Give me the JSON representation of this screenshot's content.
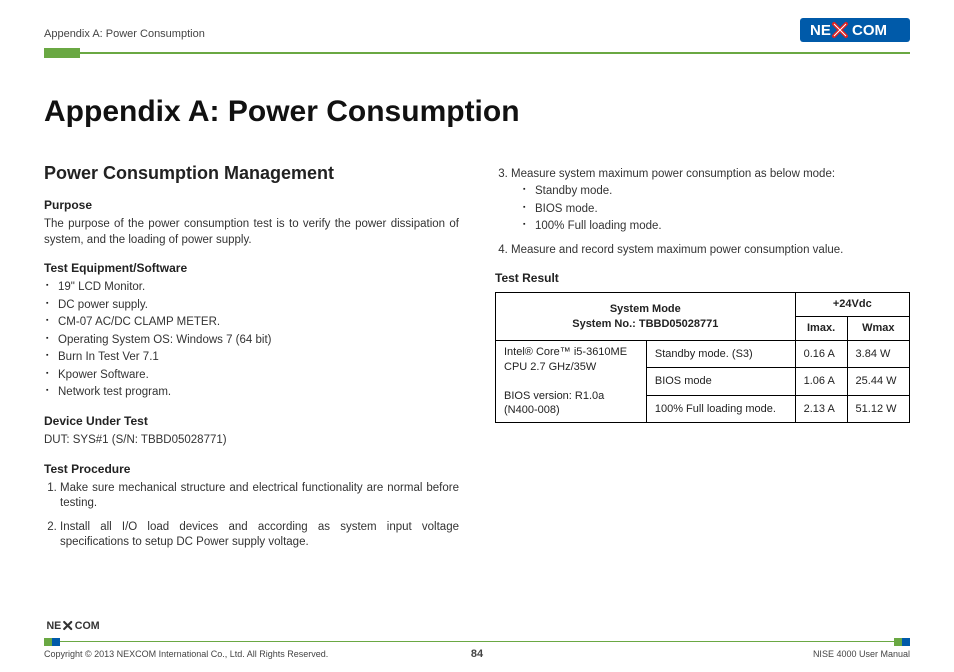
{
  "header": {
    "running_head": "Appendix A: Power Consumption",
    "logo_text_left": "NE",
    "logo_text_right": "COM"
  },
  "title": "Appendix A: Power Consumption",
  "left": {
    "section_title": "Power Consumption Management",
    "purpose_h": "Purpose",
    "purpose_p": "The purpose of the power consumption test is to verify the power dissipation of system, and the loading of power supply.",
    "equip_h": "Test Equipment/Software",
    "equip": [
      "19\" LCD Monitor.",
      "DC power supply.",
      "CM-07 AC/DC CLAMP METER.",
      "Operating System OS: Windows 7 (64 bit)",
      "Burn In Test Ver 7.1",
      "Kpower Software.",
      "Network test program."
    ],
    "dut_h": "Device Under Test",
    "dut_p": "DUT: SYS#1 (S/N: TBBD05028771)",
    "proc_h": "Test Procedure",
    "proc1": "Make sure mechanical structure and electrical functionality are normal before testing.",
    "proc2": "Install all I/O load devices and according as system input voltage specifications to setup DC Power supply voltage."
  },
  "right": {
    "proc3_lead": "Measure system maximum power consumption as below mode:",
    "proc3_items": [
      "Standby mode.",
      "BIOS mode.",
      "100% Full loading mode."
    ],
    "proc4": "Measure and record system maximum power consumption value.",
    "result_h": "Test Result",
    "table": {
      "sys_mode_h": "System Mode",
      "sys_no_h": "System No.: TBBD05028771",
      "voltage_h": "+24Vdc",
      "imax_h": "Imax.",
      "wmax_h": "Wmax",
      "cpu_line1": "Intel® Core™ i5-3610ME",
      "cpu_line2": "CPU 2.7 GHz/35W",
      "bios_line1": "BIOS version: R1.0a",
      "bios_line2": "(N400-008)",
      "rows": [
        {
          "mode": "Standby mode. (S3)",
          "imax": "0.16 A",
          "wmax": "3.84 W"
        },
        {
          "mode": "BIOS mode",
          "imax": "1.06 A",
          "wmax": "25.44 W"
        },
        {
          "mode": "100% Full loading mode.",
          "imax": "2.13 A",
          "wmax": "51.12 W"
        }
      ]
    }
  },
  "footer": {
    "copyright": "Copyright © 2013 NEXCOM International Co., Ltd. All Rights Reserved.",
    "page_no": "84",
    "manual": "NISE 4000 User Manual"
  }
}
